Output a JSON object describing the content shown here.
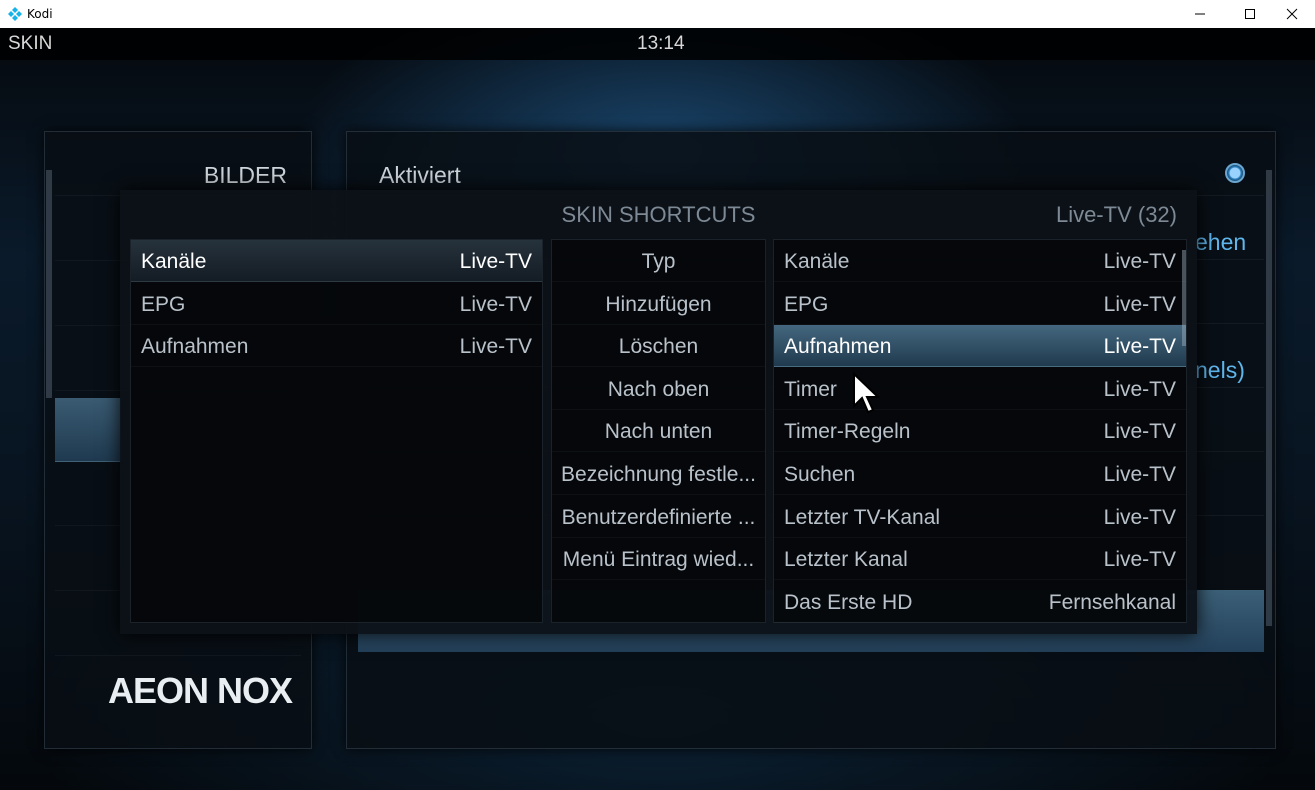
{
  "window": {
    "title": "Kodi",
    "controls": {
      "minimize": "minimize",
      "maximize": "maximize",
      "close": "close"
    }
  },
  "topbar": {
    "section": "SKIN",
    "clock": "13:14"
  },
  "sidebar": {
    "heading": "BILDER",
    "logo_text": "AEON NOX"
  },
  "main": {
    "setting_label": "Aktiviert",
    "peek_1": "ehen",
    "peek_2": "nels)"
  },
  "dialog": {
    "title": "SKIN SHORTCUTS",
    "count": "Live-TV (32)",
    "left_items": [
      {
        "label": "Kanäle",
        "type": "Live-TV"
      },
      {
        "label": "EPG",
        "type": "Live-TV"
      },
      {
        "label": "Aufnahmen",
        "type": "Live-TV"
      }
    ],
    "middle_items": [
      "Typ",
      "Hinzufügen",
      "Löschen",
      "Nach oben",
      "Nach unten",
      "Bezeichnung festle...",
      "Benutzerdefinierte ...",
      "Menü Eintrag wied..."
    ],
    "right_items": [
      {
        "label": "Kanäle",
        "type": "Live-TV"
      },
      {
        "label": "EPG",
        "type": "Live-TV"
      },
      {
        "label": "Aufnahmen",
        "type": "Live-TV"
      },
      {
        "label": "Timer",
        "type": "Live-TV"
      },
      {
        "label": "Timer-Regeln",
        "type": "Live-TV"
      },
      {
        "label": "Suchen",
        "type": "Live-TV"
      },
      {
        "label": "Letzter TV-Kanal",
        "type": "Live-TV"
      },
      {
        "label": "Letzter Kanal",
        "type": "Live-TV"
      },
      {
        "label": "Das Erste HD",
        "type": "Fernsehkanal"
      }
    ]
  },
  "colors": {
    "accent": "#5fb6ec",
    "selection": "#44677f"
  }
}
